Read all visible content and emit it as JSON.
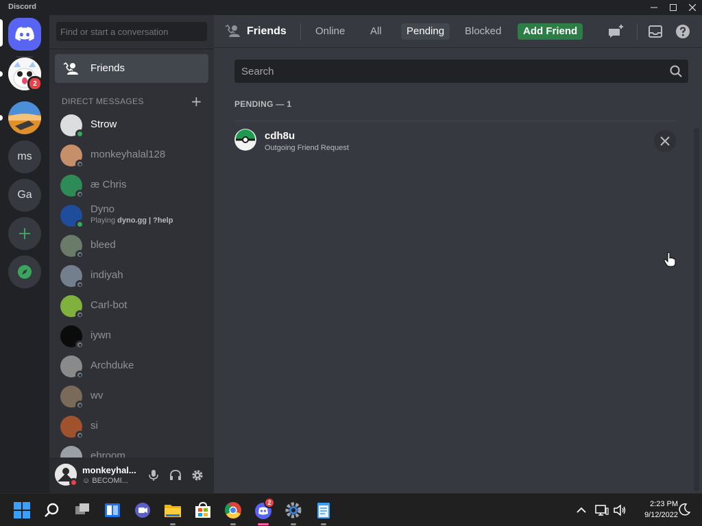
{
  "window": {
    "title": "Discord"
  },
  "servers": {
    "badge_count": "2",
    "items": [
      {
        "label": "ms"
      },
      {
        "label": "Ga"
      }
    ]
  },
  "dm_sidebar": {
    "search_placeholder": "Find or start a conversation",
    "friends_label": "Friends",
    "section_title": "DIRECT MESSAGES",
    "add_symbol": "+",
    "dms": [
      {
        "name": "Strow",
        "status": "online",
        "unread": true,
        "color": "#dcddde"
      },
      {
        "name": "monkeyhalal128",
        "status": "offline",
        "color": "#c58f6a"
      },
      {
        "name": "æ Chris",
        "status": "offline",
        "color": "#2e8b57"
      },
      {
        "name": "Dyno",
        "status": "online",
        "activity_prefix": "Playing ",
        "activity": "dyno.gg | ?help",
        "color": "#1f4d9b"
      },
      {
        "name": "bleed",
        "status": "offline",
        "color": "#6b7b6a"
      },
      {
        "name": "indiyah",
        "status": "offline",
        "color": "#747f8d"
      },
      {
        "name": "Carl-bot",
        "status": "offline",
        "color": "#7fb13c"
      },
      {
        "name": "iywn",
        "status": "offline",
        "color": "#0b0b0b"
      },
      {
        "name": "Archduke",
        "status": "offline",
        "color": "#8a8a8a"
      },
      {
        "name": "wv",
        "status": "offline",
        "color": "#7a6a5a"
      },
      {
        "name": "si",
        "status": "offline",
        "color": "#a0522d"
      },
      {
        "name": "ehroom",
        "status": "offline",
        "color": "#9aa0a6"
      }
    ]
  },
  "user_panel": {
    "username": "monkeyhal...",
    "custom_status": "☺ BECOMI..."
  },
  "topbar": {
    "title": "Friends",
    "tabs": [
      {
        "label": "Online",
        "active": false
      },
      {
        "label": "All",
        "active": false
      },
      {
        "label": "Pending",
        "active": true
      },
      {
        "label": "Blocked",
        "active": false
      }
    ],
    "add_friend_label": "Add Friend"
  },
  "pending": {
    "search_placeholder": "Search",
    "section_title": "PENDING — 1",
    "requests": [
      {
        "name": "cdh8u",
        "subtitle": "Outgoing Friend Request"
      }
    ]
  },
  "taskbar": {
    "time": "2:23 PM",
    "date": "9/12/2022",
    "discord_badge": "2"
  },
  "colors": {
    "blurple": "#5865f2",
    "green": "#3ba55d",
    "add_friend_green": "#2d7d46",
    "red": "#ed4245"
  }
}
